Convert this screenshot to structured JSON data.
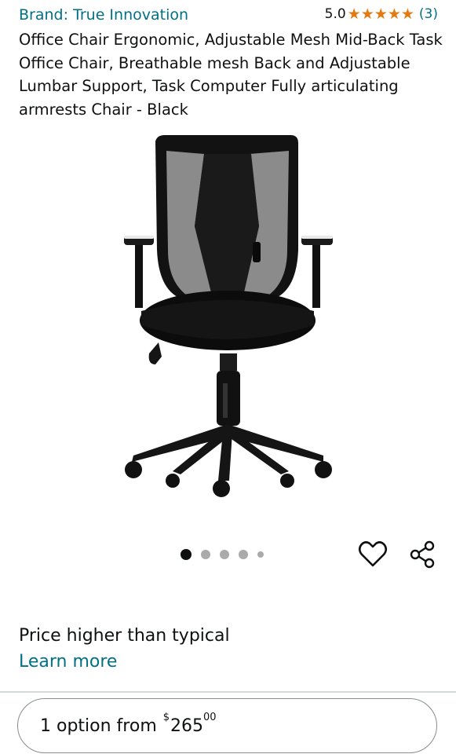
{
  "brand": {
    "text": "Brand: True Innovation"
  },
  "rating": {
    "value": "5.0",
    "stars": 5,
    "count": "(3)",
    "star_glyph": "★",
    "star_color": "#e47911"
  },
  "product": {
    "title": "Office Chair Ergonomic, Adjustable Mesh Mid-Back Task Office Chair, Breathable mesh Back and Adjustable Lumbar Support, Task Computer Fully articulating armrests Chair - Black",
    "image_icon": "office-chair-image"
  },
  "carousel": {
    "total": 5,
    "active_index": 0
  },
  "actions": {
    "wishlist_icon": "heart-icon",
    "share_icon": "share-icon"
  },
  "pricing": {
    "note": "Price higher than typical",
    "learn_more": "Learn more"
  },
  "buy_option": {
    "label": "1 option from",
    "currency": "$",
    "whole": "265",
    "fraction": "00"
  },
  "colors": {
    "link": "#007185",
    "text": "#0f1111",
    "divider": "#d5d9d9"
  }
}
